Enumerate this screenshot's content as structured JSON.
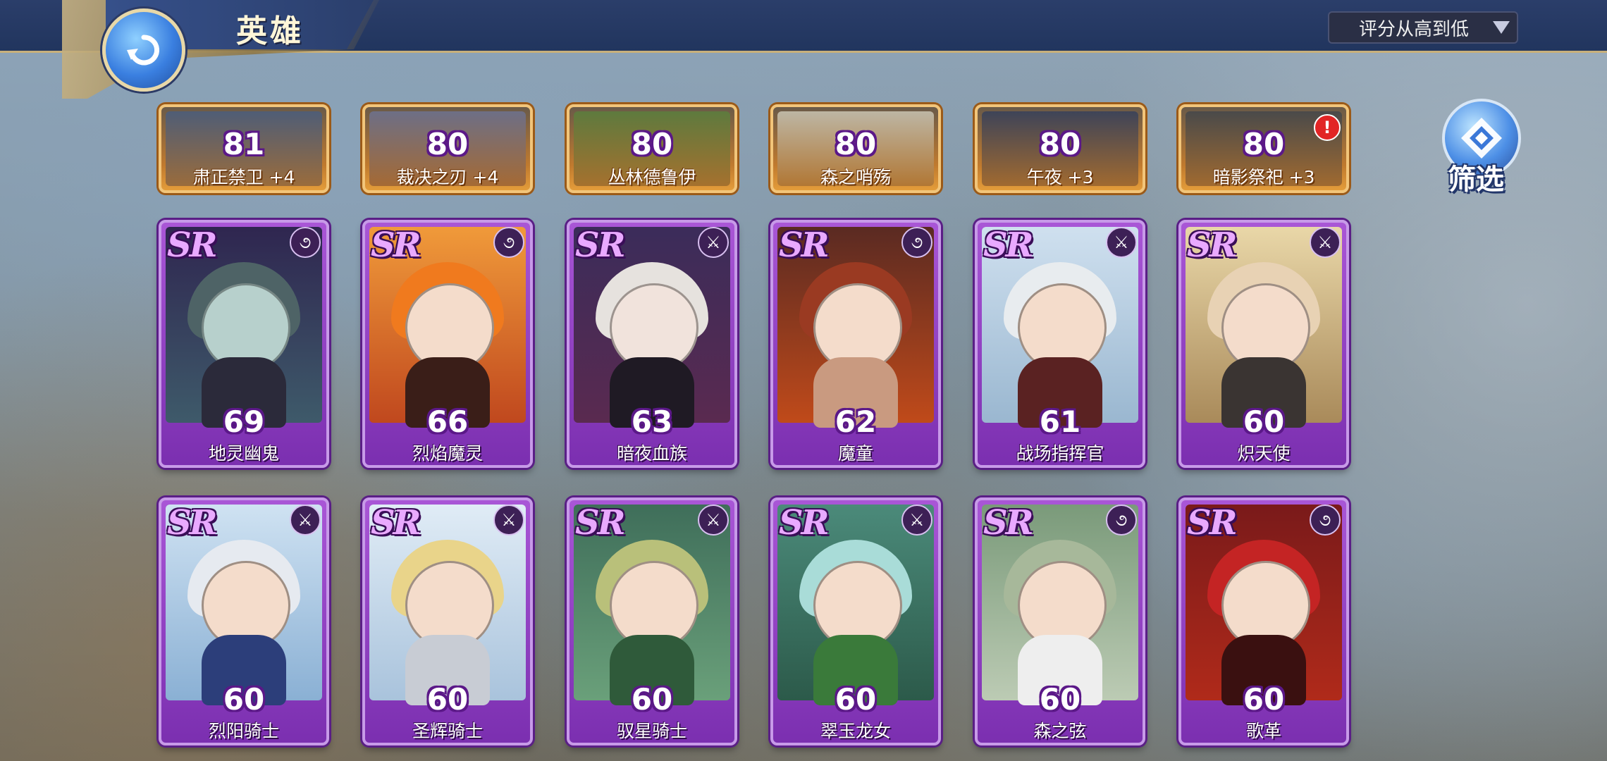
{
  "header": {
    "title": "英雄",
    "sort_label": "评分从高到低"
  },
  "filter": {
    "label": "筛选"
  },
  "top_row": [
    {
      "level": "81",
      "name": "肃正禁卫 +4"
    },
    {
      "level": "80",
      "name": "裁决之刃 +4"
    },
    {
      "level": "80",
      "name": "丛林德鲁伊"
    },
    {
      "level": "80",
      "name": "森之哨殇"
    },
    {
      "level": "80",
      "name": "午夜 +3"
    },
    {
      "level": "80",
      "name": "暗影祭祀 +3",
      "alert": "!"
    }
  ],
  "sr_row_1": [
    {
      "rank": "SR",
      "level": "69",
      "name": "地灵幽鬼",
      "class_icon": "staff-icon"
    },
    {
      "rank": "SR",
      "level": "66",
      "name": "烈焰魔灵",
      "class_icon": "staff-icon"
    },
    {
      "rank": "SR",
      "level": "63",
      "name": "暗夜血族",
      "class_icon": "crossed-swords-icon"
    },
    {
      "rank": "SR",
      "level": "62",
      "name": "魔童",
      "class_icon": "staff-icon"
    },
    {
      "rank": "SR",
      "level": "61",
      "name": "战场指挥官",
      "class_icon": "crossed-swords-icon"
    },
    {
      "rank": "SR",
      "level": "60",
      "name": "炽天使",
      "class_icon": "crossed-swords-icon"
    }
  ],
  "sr_row_2": [
    {
      "rank": "SR",
      "level": "60",
      "name": "烈阳骑士",
      "class_icon": "crossed-swords-icon"
    },
    {
      "rank": "SR",
      "level": "60",
      "name": "圣辉骑士",
      "class_icon": "crossed-swords-icon"
    },
    {
      "rank": "SR",
      "level": "60",
      "name": "驭星骑士",
      "class_icon": "crossed-swords-icon"
    },
    {
      "rank": "SR",
      "level": "60",
      "name": "翠玉龙女",
      "class_icon": "crossed-swords-icon"
    },
    {
      "rank": "SR",
      "level": "60",
      "name": "森之弦",
      "class_icon": "staff-icon"
    },
    {
      "rank": "SR",
      "level": "60",
      "name": "歌革",
      "class_icon": "staff-icon"
    }
  ],
  "colors": {
    "sr_card": "#8e3cc4",
    "top_card": "#d98a34",
    "topbar": "#2b3e6a"
  }
}
